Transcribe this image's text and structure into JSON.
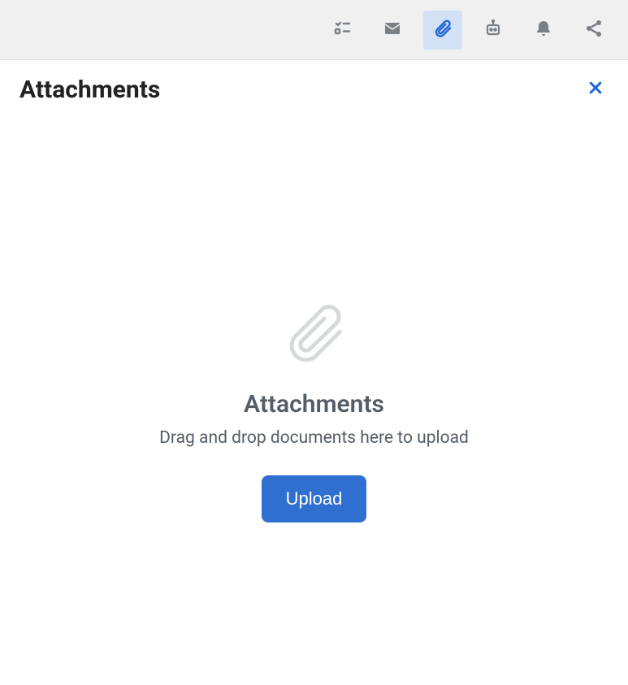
{
  "toolbar": {
    "items": [
      {
        "name": "tasklist-icon",
        "active": false
      },
      {
        "name": "envelope-icon",
        "active": false
      },
      {
        "name": "paperclip-icon",
        "active": true
      },
      {
        "name": "bot-icon",
        "active": false
      },
      {
        "name": "bell-icon",
        "active": false
      },
      {
        "name": "share-icon",
        "active": false
      }
    ]
  },
  "panel": {
    "title": "Attachments"
  },
  "emptyState": {
    "title": "Attachments",
    "subtitle": "Drag and drop documents here to upload",
    "button": "Upload"
  },
  "colors": {
    "accent": "#2f6fcf",
    "toolbarBg": "#f0f0f0",
    "iconMuted": "#7a7f85",
    "iconActive": "#1f66d6",
    "textMuted": "#555d66"
  }
}
